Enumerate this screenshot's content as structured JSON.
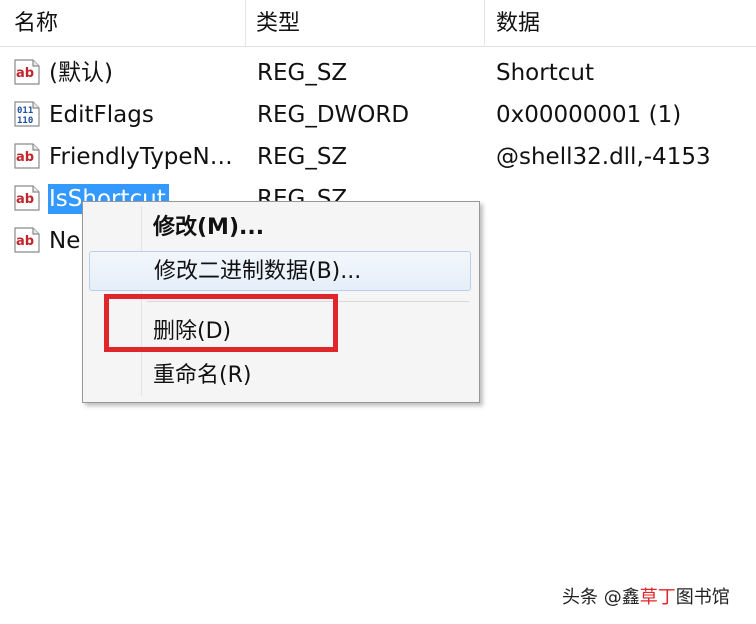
{
  "columns": {
    "name": "名称",
    "type": "类型",
    "data": "数据"
  },
  "rows": [
    {
      "icon": "string-value-icon",
      "name": "(默认)",
      "type": "REG_SZ",
      "value": "Shortcut"
    },
    {
      "icon": "binary-value-icon",
      "name": "EditFlags",
      "type": "REG_DWORD",
      "value": "0x00000001 (1)"
    },
    {
      "icon": "string-value-icon",
      "name": "FriendlyTypeN…",
      "type": "REG_SZ",
      "value": "@shell32.dll,-4153"
    },
    {
      "icon": "string-value-icon",
      "name": "IsShortcut",
      "type": "REG_SZ",
      "value": ""
    },
    {
      "icon": "string-value-icon",
      "name": "Ne",
      "type": "",
      "value": ""
    }
  ],
  "context_menu": {
    "items": [
      {
        "label": "修改(M)..."
      },
      {
        "label": "修改二进制数据(B)..."
      },
      {
        "label": "删除(D)"
      },
      {
        "label": "重命名(R)"
      }
    ]
  },
  "watermark": {
    "prefix": "头条 @鑫",
    "accent": "草丁",
    "suffix": "图书馆"
  },
  "colors": {
    "selection": "#3399ff",
    "highlight_box": "#e0262a",
    "string_icon_text": "#c0262c",
    "binary_icon_text": "#1f4e9c"
  }
}
